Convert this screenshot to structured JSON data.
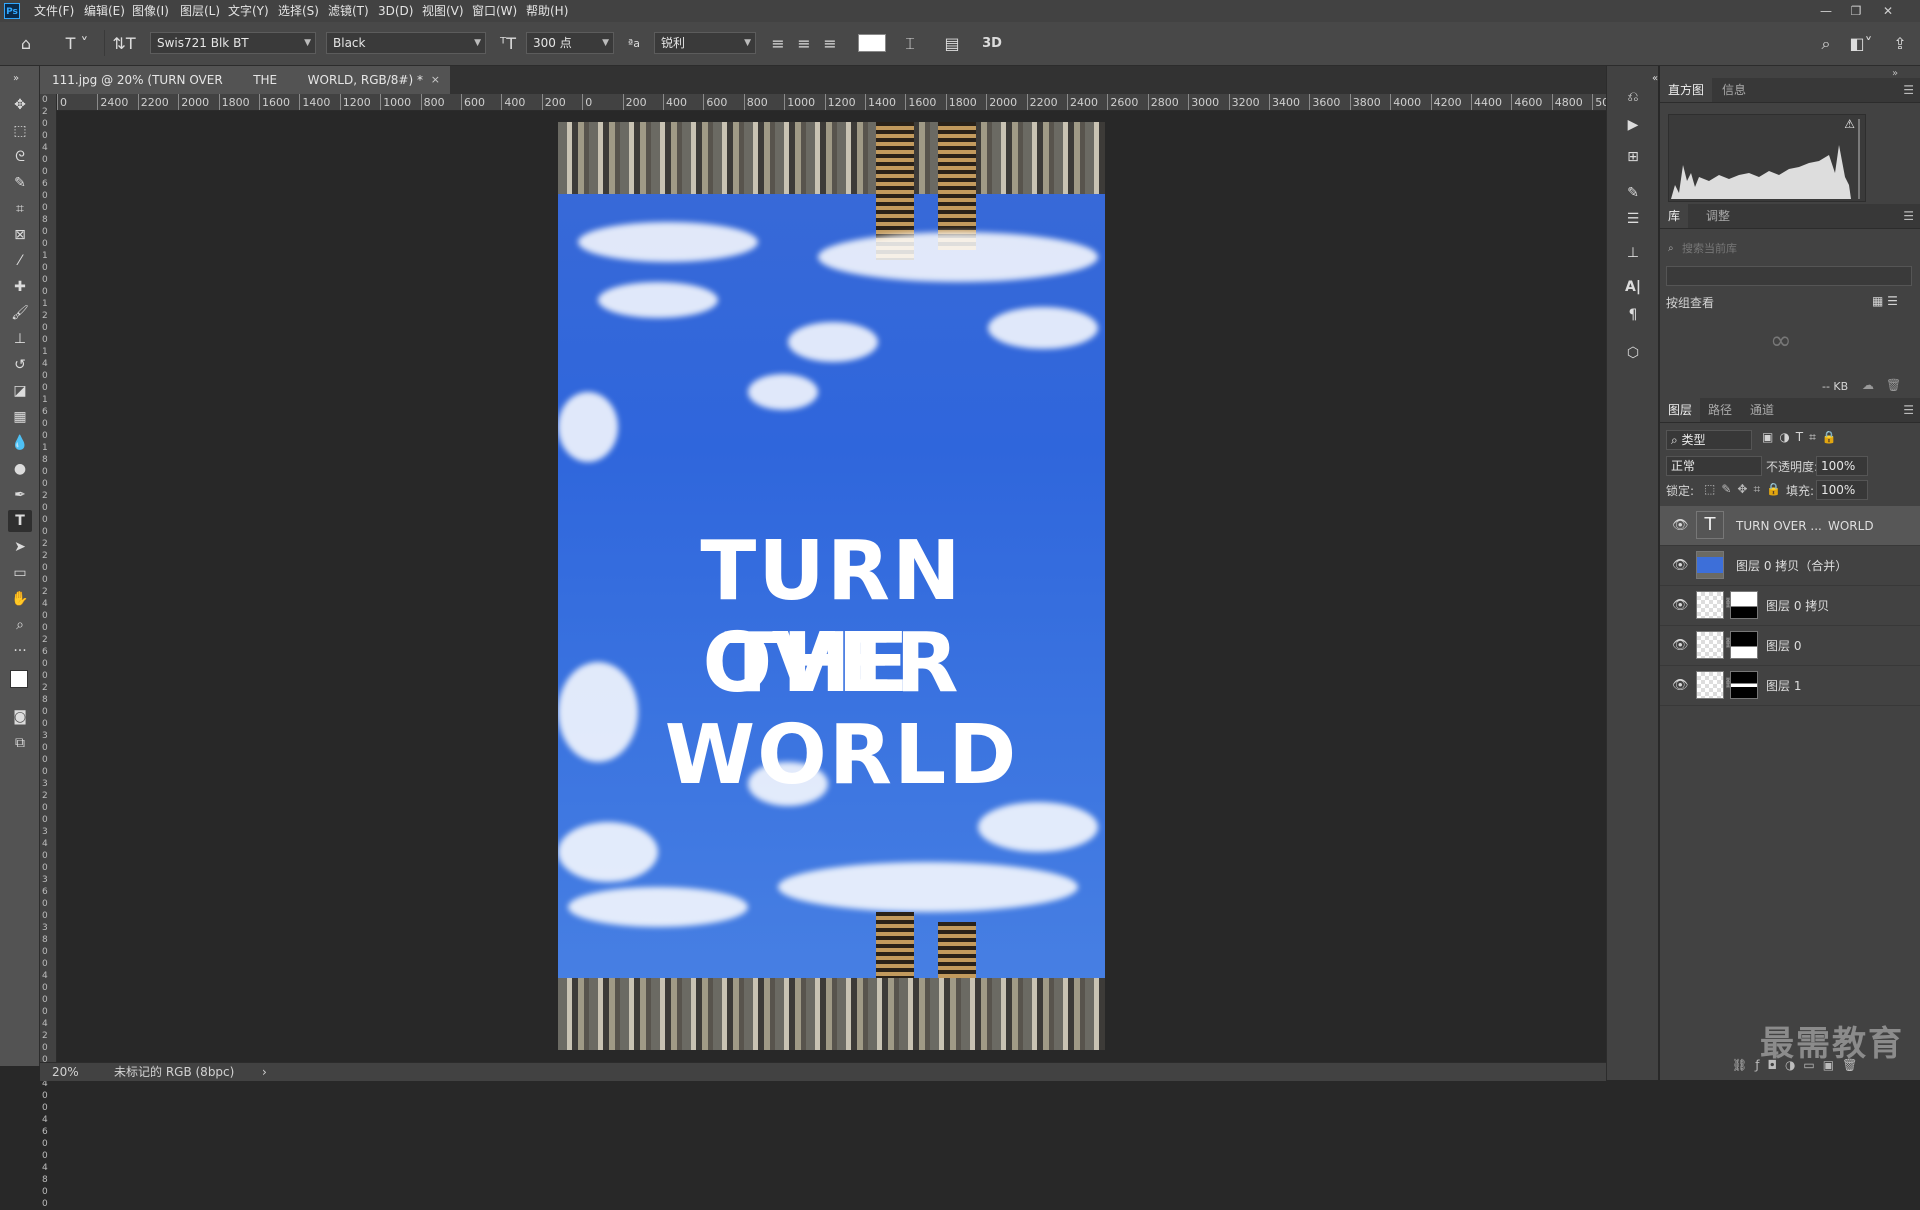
{
  "app": {
    "logo": "Ps"
  },
  "menu": [
    "文件(F)",
    "编辑(E)",
    "图像(I)",
    "图层(L)",
    "文字(Y)",
    "选择(S)",
    "滤镜(T)",
    "3D(D)",
    "视图(V)",
    "窗口(W)",
    "帮助(H)"
  ],
  "window_controls": {
    "minimize": "—",
    "restore": "❐",
    "close": "✕"
  },
  "options": {
    "font_family": "Swis721 Blk BT",
    "font_style": "Black",
    "font_size": "300 点",
    "antialias_icon_label": "ªa",
    "antialias": "锐利",
    "threeD": "3D"
  },
  "document_tab": {
    "title": "111.jpg @ 20% (TURN OVER        THE        WORLD, RGB/8#) *",
    "close": "×"
  },
  "hruler_ticks": [
    "0",
    "2400",
    "2200",
    "2000",
    "1800",
    "1600",
    "1400",
    "1200",
    "1000",
    "800",
    "600",
    "400",
    "200",
    "0",
    "200",
    "400",
    "600",
    "800",
    "1000",
    "1200",
    "1400",
    "1600",
    "1800",
    "2000",
    "2200",
    "2400",
    "2600",
    "2800",
    "3000",
    "3200",
    "3400",
    "3600",
    "3800",
    "4000",
    "4200",
    "4400",
    "4600",
    "4800",
    "5000",
    "5"
  ],
  "vruler_labels": "0 2 0 0 4 0 0 6 0 0 8 0 0 1 0 0 0 1 2 0 0 1 4 0 0 1 6 0 0 1 8 0 0 2 0 0 0 2 2 0 0 2 4 0 0 2 6 0 0 2 8 0 0 3 0 0 0 3 2 0 0 3 4 0 0 3 6 0 0 3 8 0 0 4 0 0 0 4 2 0 0 4 4 0 0 4 6 0 0 4 8 0 0",
  "canvas_text": {
    "line1": "TURN OVER",
    "line2": "THE",
    "line3": "WORLD"
  },
  "status": {
    "zoom": "20%",
    "profile": "未标记的 RGB (8bpc)",
    "arrow": "›"
  },
  "histogram_panel": {
    "tabs": [
      "直方图",
      "信息"
    ],
    "warning": "⚠"
  },
  "library_panel": {
    "tabs": [
      "库",
      "调整"
    ],
    "search_placeholder": "搜索当前库",
    "view_by": "按组查看",
    "size": "-- KB"
  },
  "layers_panel": {
    "tabs": [
      "图层",
      "路径",
      "通道"
    ],
    "filter_kind": "类型",
    "blend_mode": "正常",
    "opacity_label": "不透明度:",
    "opacity": "100%",
    "lock_label": "锁定:",
    "fill_label": "填充:",
    "fill": "100%",
    "layers": [
      {
        "name": "TURN OVER ...",
        "name2": "WORLD",
        "type": "text",
        "selected": true
      },
      {
        "name": "图层 0 拷贝（合并）",
        "type": "photo"
      },
      {
        "name": "图层 0 拷贝",
        "type": "masked"
      },
      {
        "name": "图层 0",
        "type": "masked"
      },
      {
        "name": "图层 1",
        "type": "masked"
      }
    ],
    "footer_icons": [
      "link-icon",
      "fx-icon",
      "mask-icon",
      "adjustment-icon",
      "folder-icon",
      "new-layer-icon",
      "trash-icon"
    ]
  },
  "watermark": "最需教育"
}
